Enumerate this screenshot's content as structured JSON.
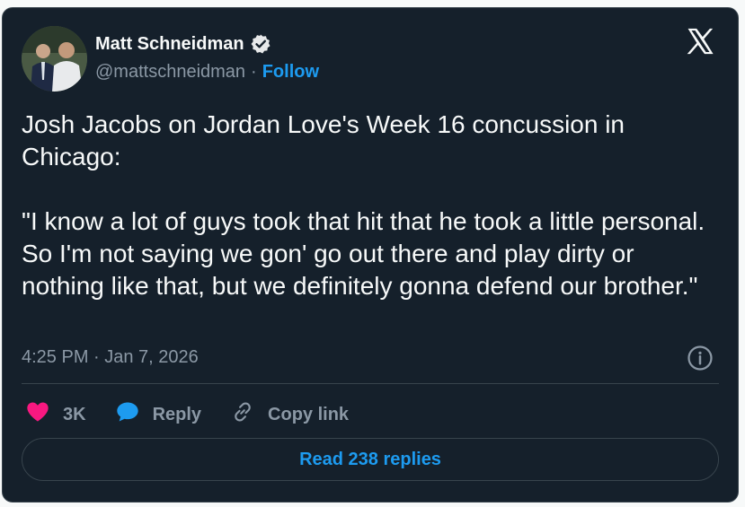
{
  "author": {
    "name": "Matt Schneidman",
    "handle": "@mattschneidman",
    "separator": "·",
    "follow_label": "Follow",
    "verified": true
  },
  "tweet": {
    "text": "Josh Jacobs on Jordan Love's Week 16 concussion in Chicago:\n\n\"I know a lot of guys took that hit that he took a little personal. So I'm not saying we gon' go out there and play dirty or nothing like that, but we definitely gonna defend our brother.\"",
    "timestamp": "4:25 PM · Jan 7, 2026"
  },
  "actions": {
    "like_count": "3K",
    "reply_label": "Reply",
    "copy_label": "Copy link"
  },
  "read_replies_label": "Read 238 replies",
  "colors": {
    "background": "#15202b",
    "accent": "#1d9bf0",
    "like": "#f91880",
    "muted": "#8b98a5"
  },
  "icons": [
    "verified-badge-icon",
    "x-logo-icon",
    "info-icon",
    "heart-icon",
    "reply-bubble-icon",
    "link-icon"
  ]
}
